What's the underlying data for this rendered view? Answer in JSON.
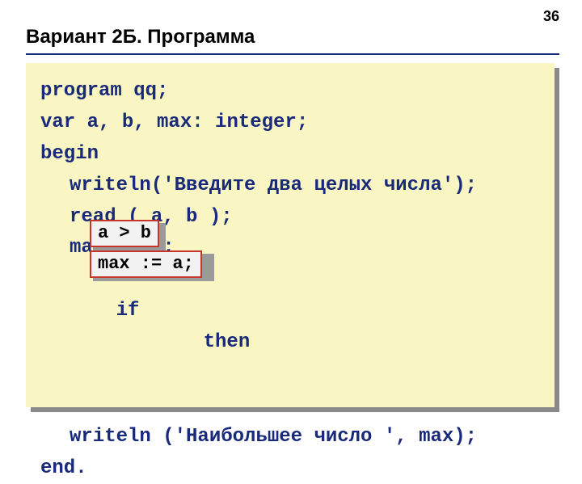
{
  "page_number": "36",
  "title": "Вариант 2Б. Программа",
  "code": {
    "l1": "program qq;",
    "l2": "var a, b, max: integer;",
    "l3": "begin",
    "l4": "writeln('Введите два целых числа');",
    "l5": "read ( a, b );",
    "l6": "max := b;",
    "l7_if": "if",
    "l7_then": "then",
    "l8_placeholder": " ",
    "l9": "writeln ('Наибольшее число ', max);",
    "l10": "end."
  },
  "fill": {
    "condition": "a > b",
    "assignment": "max := a;"
  }
}
